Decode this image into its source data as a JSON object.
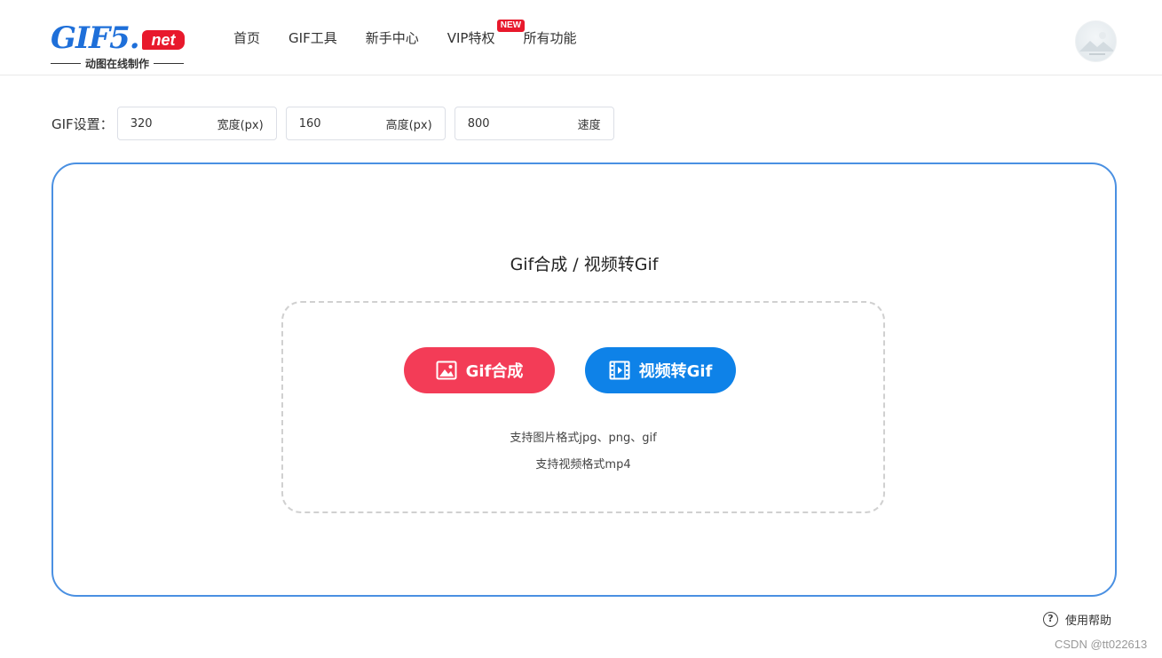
{
  "brand": {
    "logo_text": "GIF5.",
    "logo_badge": "net",
    "tagline": "动图在线制作"
  },
  "nav": {
    "items": [
      {
        "label": "首页"
      },
      {
        "label": "GIF工具"
      },
      {
        "label": "新手中心"
      },
      {
        "label": "VIP特权",
        "badge": "NEW"
      },
      {
        "label": "所有功能"
      }
    ]
  },
  "settings": {
    "label": "GIF设置：",
    "width": {
      "value": "320",
      "unit": "宽度(px)"
    },
    "height": {
      "value": "160",
      "unit": "高度(px)"
    },
    "speed": {
      "value": "800",
      "unit": "速度"
    }
  },
  "panel": {
    "title": "Gif合成 / 视频转Gif",
    "gif_button": "Gif合成",
    "video_button": "视频转Gif",
    "hint_image": "支持图片格式jpg、png、gif",
    "hint_video": "支持视频格式mp4"
  },
  "footer": {
    "help_label": "使用帮助",
    "help_icon": "?",
    "watermark": "CSDN @tt022613"
  },
  "colors": {
    "accent_blue": "#4a90e2",
    "gif_button": "#f33c57",
    "video_button": "#0e82e8",
    "badge_red": "#e8192c"
  }
}
